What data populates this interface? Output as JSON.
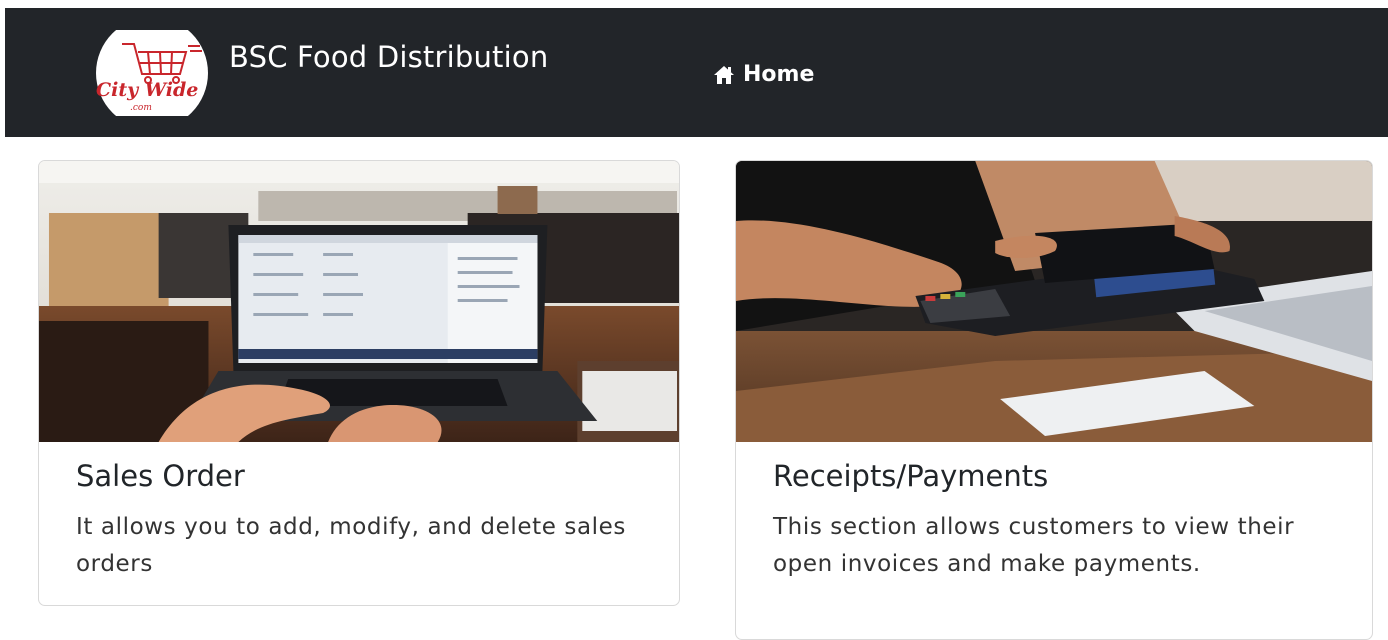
{
  "navbar": {
    "logo_text": "City Wide",
    "brand": "BSC Food Distribution",
    "home_label": "Home",
    "home_icon": "home-icon",
    "bg_color": "#222529"
  },
  "cards": [
    {
      "title": "Sales Order",
      "text": "It allows you to add, modify, and delete sales orders",
      "image": "laptop-photo"
    },
    {
      "title": "Receipts/Payments",
      "text": "This section allows customers to view their open invoices and make payments.",
      "image": "card-payment-photo"
    }
  ]
}
